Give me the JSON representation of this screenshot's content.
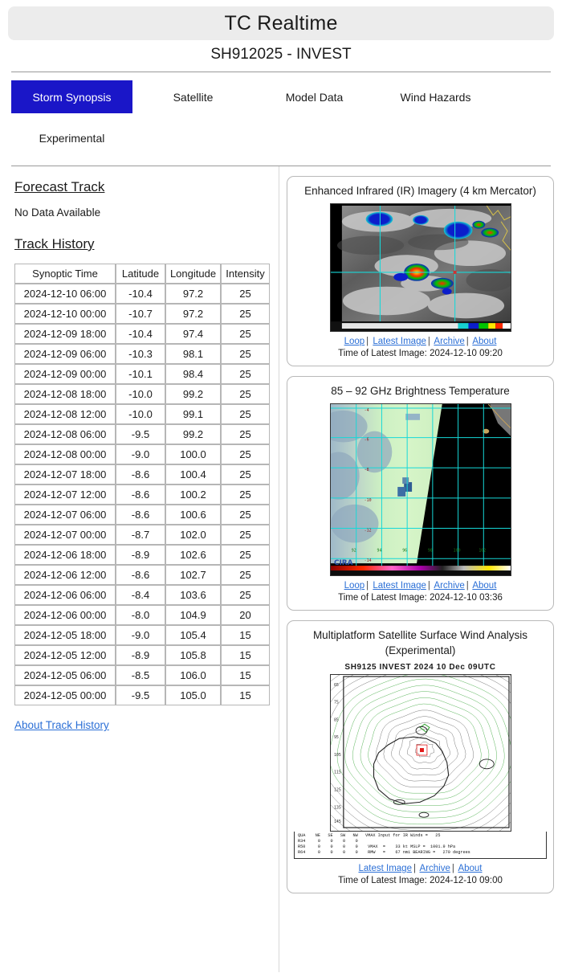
{
  "header": {
    "app_title": "TC Realtime",
    "storm_id": "SH912025 - INVEST"
  },
  "tabs": [
    {
      "label": "Storm Synopsis",
      "active": true
    },
    {
      "label": "Satellite",
      "active": false
    },
    {
      "label": "Model Data",
      "active": false
    },
    {
      "label": "Wind Hazards",
      "active": false
    },
    {
      "label": "Experimental",
      "active": false
    }
  ],
  "accent_color": "#1a16c8",
  "link_color": "#2b6fd6",
  "left": {
    "forecast_track_heading": "Forecast Track",
    "forecast_track_message": "No Data Available",
    "track_history_heading": "Track History",
    "about_link": "About Track History",
    "table": {
      "columns": [
        "Synoptic Time",
        "Latitude",
        "Longitude",
        "Intensity"
      ],
      "rows": [
        [
          "2024-12-10 06:00",
          "-10.4",
          "97.2",
          "25"
        ],
        [
          "2024-12-10 00:00",
          "-10.7",
          "97.2",
          "25"
        ],
        [
          "2024-12-09 18:00",
          "-10.4",
          "97.4",
          "25"
        ],
        [
          "2024-12-09 06:00",
          "-10.3",
          "98.1",
          "25"
        ],
        [
          "2024-12-09 00:00",
          "-10.1",
          "98.4",
          "25"
        ],
        [
          "2024-12-08 18:00",
          "-10.0",
          "99.2",
          "25"
        ],
        [
          "2024-12-08 12:00",
          "-10.0",
          "99.1",
          "25"
        ],
        [
          "2024-12-08 06:00",
          "-9.5",
          "99.2",
          "25"
        ],
        [
          "2024-12-08 00:00",
          "-9.0",
          "100.0",
          "25"
        ],
        [
          "2024-12-07 18:00",
          "-8.6",
          "100.4",
          "25"
        ],
        [
          "2024-12-07 12:00",
          "-8.6",
          "100.2",
          "25"
        ],
        [
          "2024-12-07 06:00",
          "-8.6",
          "100.6",
          "25"
        ],
        [
          "2024-12-07 00:00",
          "-8.7",
          "102.0",
          "25"
        ],
        [
          "2024-12-06 18:00",
          "-8.9",
          "102.6",
          "25"
        ],
        [
          "2024-12-06 12:00",
          "-8.6",
          "102.7",
          "25"
        ],
        [
          "2024-12-06 06:00",
          "-8.4",
          "103.6",
          "25"
        ],
        [
          "2024-12-06 00:00",
          "-8.0",
          "104.9",
          "20"
        ],
        [
          "2024-12-05 18:00",
          "-9.0",
          "105.4",
          "15"
        ],
        [
          "2024-12-05 12:00",
          "-8.9",
          "105.8",
          "15"
        ],
        [
          "2024-12-05 06:00",
          "-8.5",
          "106.0",
          "15"
        ],
        [
          "2024-12-05 00:00",
          "-9.5",
          "105.0",
          "15"
        ]
      ]
    }
  },
  "panels": [
    {
      "title": "Enhanced Infrared (IR) Imagery (4 km Mercator)",
      "links": [
        "Loop",
        "Latest Image",
        "Archive",
        "About"
      ],
      "timestamp": "Time of Latest Image: 2024-12-10 09:20"
    },
    {
      "title": "85 – 92 GHz Brightness Temperature",
      "links": [
        "Loop",
        "Latest Image",
        "Archive",
        "About"
      ],
      "timestamp": "Time of Latest Image: 2024-12-10 03:36"
    },
    {
      "title": "Multiplatform Satellite Surface Wind Analysis (Experimental)",
      "subtitle": "SH9125     INVEST     2024 10 Dec 09UTC",
      "links": [
        "Latest Image",
        "Archive",
        "About"
      ],
      "timestamp": "Time of Latest Image: 2024-12-10 09:00",
      "stats_text": "QUA    NE   SE   SW   NW   VMAX Input for IR Winds =   25\nR34     0    0    0    0\nR50     0    0    0    0    VMAX  =    33 kt MSLP =  1001.9 hPa\nR64     0    0    0    0    RMW   =    67 nmi BEARING =   270 degrees"
    }
  ]
}
